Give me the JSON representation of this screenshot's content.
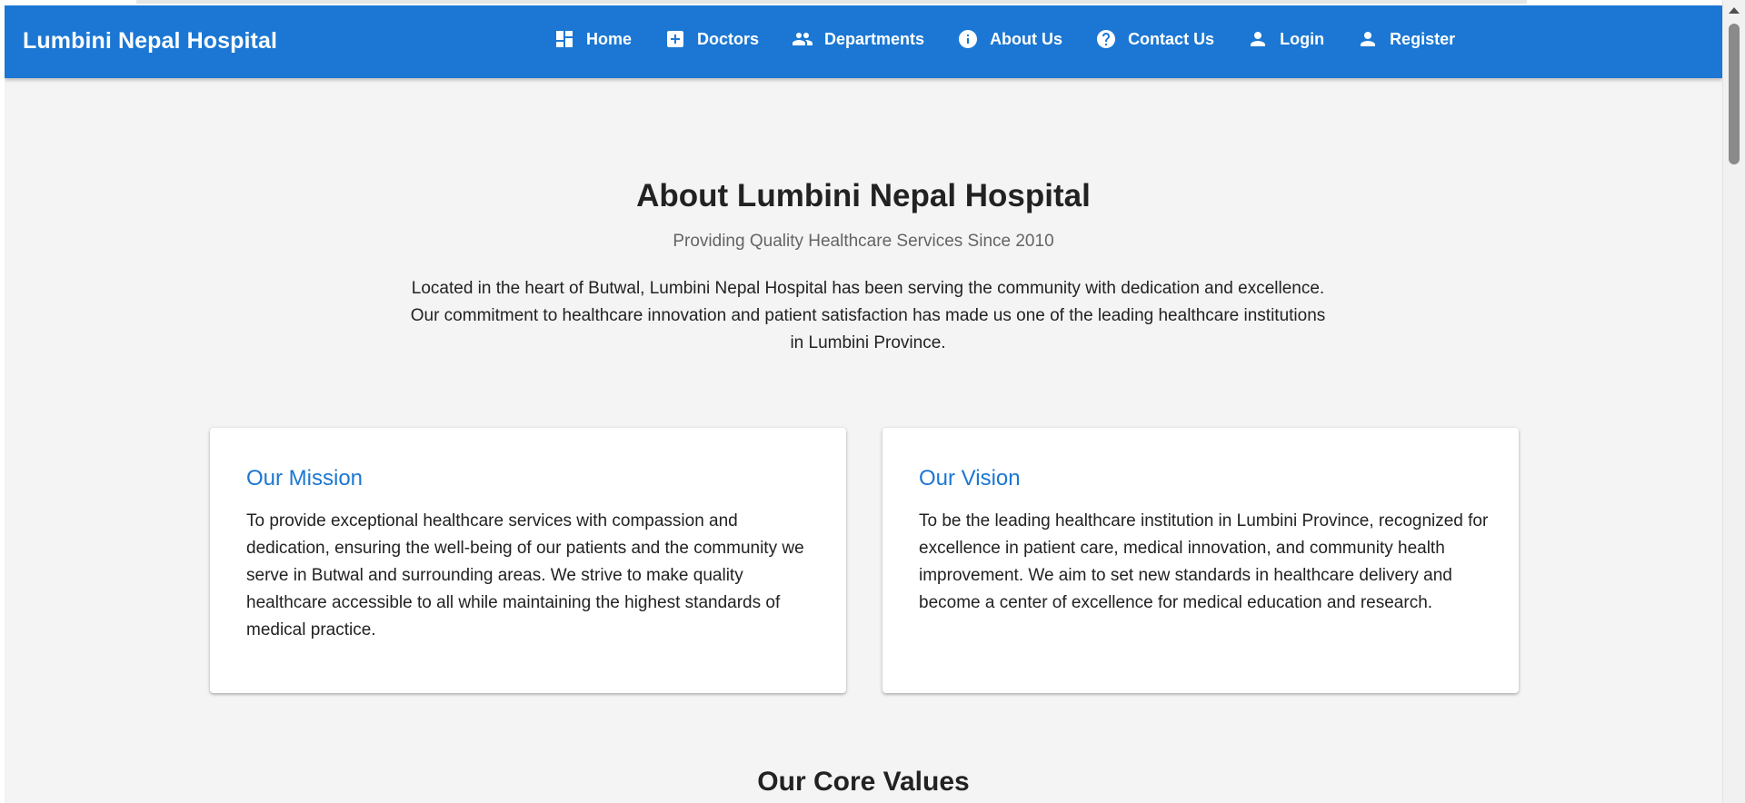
{
  "appbar": {
    "brand": "Lumbini Nepal Hospital",
    "color": "#1b77d3",
    "nav": [
      {
        "label": "Home",
        "icon": "dashboard-icon"
      },
      {
        "label": "Doctors",
        "icon": "medical-plus-icon"
      },
      {
        "label": "Departments",
        "icon": "people-icon"
      },
      {
        "label": "About Us",
        "icon": "info-icon"
      },
      {
        "label": "Contact Us",
        "icon": "help-icon"
      },
      {
        "label": "Login",
        "icon": "person-icon"
      },
      {
        "label": "Register",
        "icon": "person-icon"
      }
    ]
  },
  "about": {
    "title": "About Lumbini Nepal Hospital",
    "subtitle": "Providing Quality Healthcare Services Since 2010",
    "intro": "Located in the heart of Butwal, Lumbini Nepal Hospital has been serving the community with dedication and excellence. Our commitment to healthcare innovation and patient satisfaction has made us one of the leading healthcare institutions in Lumbini Province."
  },
  "cards": {
    "mission": {
      "title": "Our Mission",
      "text": "To provide exceptional healthcare services with compassion and dedication, ensuring the well-being of our patients and the community we serve in Butwal and surrounding areas. We strive to make quality healthcare accessible to all while maintaining the highest standards of medical practice."
    },
    "vision": {
      "title": "Our Vision",
      "text": "To be the leading healthcare institution in Lumbini Province, recognized for excellence in patient care, medical innovation, and community health improvement. We aim to set new standards in healthcare delivery and become a center of excellence for medical education and research."
    }
  },
  "core_values": {
    "title": "Our Core Values"
  }
}
